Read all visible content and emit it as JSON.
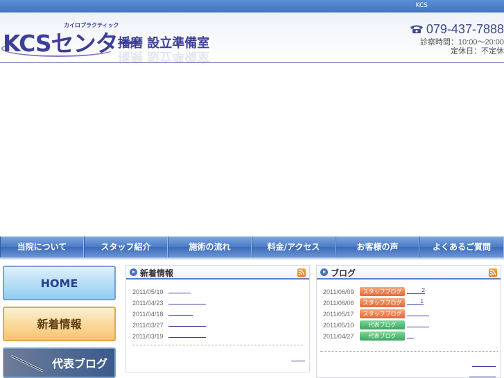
{
  "topbar": {
    "label": "KCS"
  },
  "header": {
    "logo_text": "KCSセンター",
    "logo_kana": "カイロプラクティック",
    "subtitle": "播磨 設立準備室",
    "phone": "079-437-7888",
    "hours_line1": "診察時間：10:00～20:00",
    "hours_line2": "定休日：不定休"
  },
  "nav": {
    "items": [
      {
        "label": "当院について"
      },
      {
        "label": "スタッフ紹介"
      },
      {
        "label": "施術の流れ"
      },
      {
        "label": "料金/アクセス"
      },
      {
        "label": "お客様の声"
      },
      {
        "label": "よくあるご質問"
      }
    ]
  },
  "side": {
    "home": "HOME",
    "news": "新着情報",
    "blog": "代表ブログ"
  },
  "news_panel": {
    "title": "新着情報",
    "items": [
      {
        "date": "2011/05/10"
      },
      {
        "date": "2011/04/23"
      },
      {
        "date": "2011/04/18"
      },
      {
        "date": "2011/03/27"
      },
      {
        "date": "2011/03/19"
      }
    ]
  },
  "blog_panel": {
    "title": "ブログ",
    "items": [
      {
        "date": "2011/06/09",
        "tag": "スタッフブログ",
        "link": "2"
      },
      {
        "date": "2011/06/06",
        "tag": "スタッフブログ",
        "link": "1"
      },
      {
        "date": "2011/05/17",
        "tag": "スタッフブログ",
        "link": ""
      },
      {
        "date": "2011/05/10",
        "tag": "代表ブログ",
        "link": ""
      },
      {
        "date": "2011/04/27",
        "tag": "代表ブログ",
        "link": ""
      }
    ]
  },
  "colors": {
    "brand": "#3d3f98",
    "nav": "#4a7bc7",
    "staff_tag": "#e4683a",
    "rep_tag": "#3aa75d"
  },
  "icons": [
    "phone-icon",
    "rss-icon",
    "bullet-arrow-icon",
    "pen-icon"
  ]
}
